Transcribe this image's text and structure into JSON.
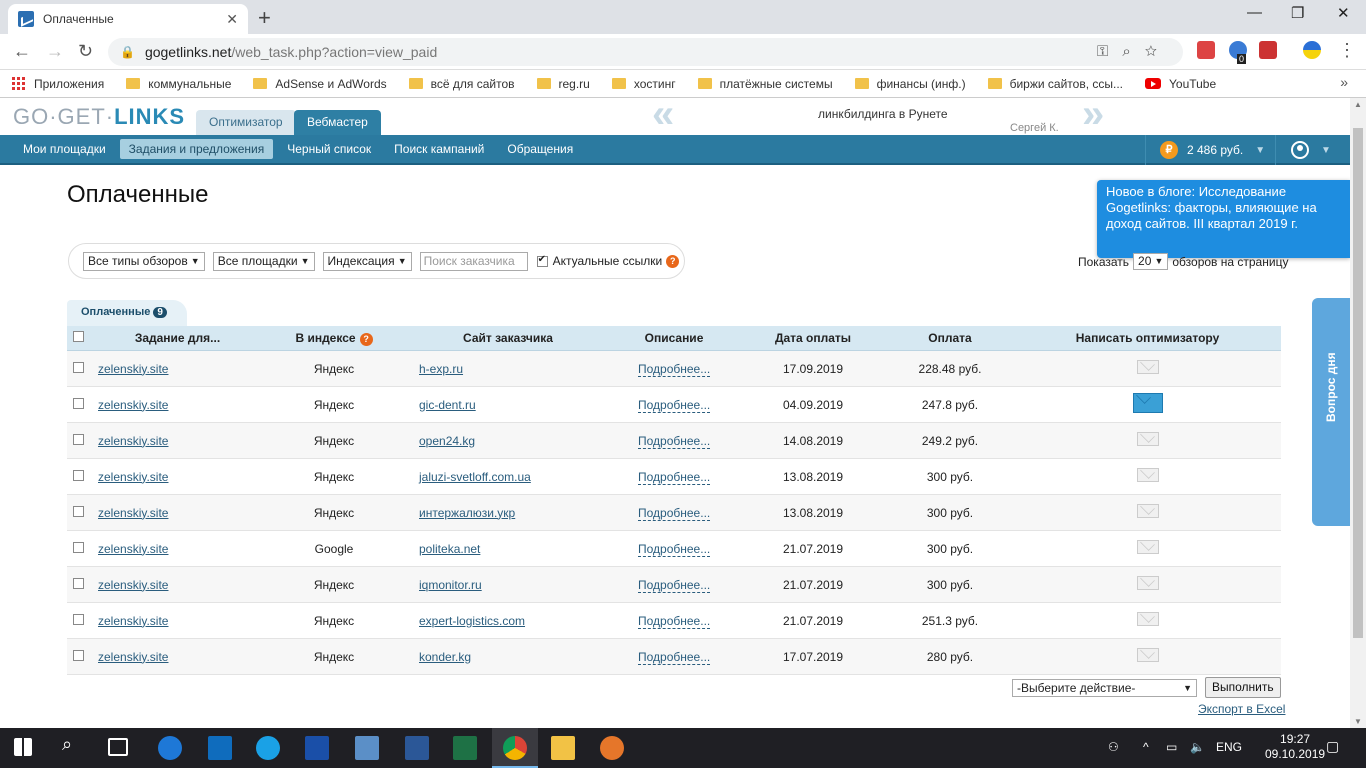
{
  "browser": {
    "tab_title": "Оплаченные",
    "url_host": "gogetlinks.net",
    "url_path": "/web_task.php?action=view_paid",
    "ext_badge": "0"
  },
  "bookmarks": [
    {
      "label": "Приложения",
      "icon": "apps-icon"
    },
    {
      "label": "коммунальные",
      "icon": "folder-icon"
    },
    {
      "label": "AdSense и AdWords",
      "icon": "folder-icon"
    },
    {
      "label": "всё для сайтов",
      "icon": "folder-icon"
    },
    {
      "label": "reg.ru",
      "icon": "folder-icon"
    },
    {
      "label": "хостинг",
      "icon": "folder-icon"
    },
    {
      "label": "платёжные системы",
      "icon": "folder-icon"
    },
    {
      "label": "финансы (инф.)",
      "icon": "folder-icon"
    },
    {
      "label": "биржи сайтов, ссы...",
      "icon": "folder-icon"
    },
    {
      "label": "YouTube",
      "icon": "youtube-icon"
    }
  ],
  "header": {
    "logo_left": "GO·GET·",
    "logo_right": "LINKS",
    "role_tabs": [
      "Оптимизатор",
      "Вебмастер"
    ],
    "banner_text": "линкбилдинга в Рунете",
    "banner_author": "Сергей К.",
    "nav": [
      "Мои площадки",
      "Задания и предложения",
      "Черный список",
      "Поиск кампаний",
      "Обращения"
    ],
    "balance": "2 486 руб.",
    "coin": "₽"
  },
  "page": {
    "title": "Оплаченные",
    "blog": "Новое в блоге: Исследование Gogetlinks: факторы, влияющие на доход сайтов. III квартал 2019 г.",
    "question_day": "Вопрос дня"
  },
  "filters": {
    "review_type": "Все типы обзоров",
    "sites": "Все площадки",
    "indexing": "Индексация",
    "customer_placeholder": "Поиск заказчика",
    "actual_links": "Актуальные ссылки",
    "perpage_prefix": "Показать",
    "perpage_value": "20",
    "perpage_suffix": "обзоров на страницу"
  },
  "table": {
    "tab_label": "Оплаченные",
    "tab_count": "9",
    "columns": [
      "Задание для...",
      "В индексе",
      "Сайт заказчика",
      "Описание",
      "Дата оплаты",
      "Оплата",
      "Написать оптимизатору"
    ],
    "rows": [
      {
        "site": "zelenskiy.site",
        "index": "Яндекс",
        "customer": "h-exp.ru",
        "desc": "Подробнее...",
        "date": "17.09.2019",
        "pay": "228.48 руб.",
        "new_msg": false
      },
      {
        "site": "zelenskiy.site",
        "index": "Яндекс",
        "customer": "gic-dent.ru",
        "desc": "Подробнее...",
        "date": "04.09.2019",
        "pay": "247.8 руб.",
        "new_msg": true
      },
      {
        "site": "zelenskiy.site",
        "index": "Яндекс",
        "customer": "open24.kg",
        "desc": "Подробнее...",
        "date": "14.08.2019",
        "pay": "249.2 руб.",
        "new_msg": false
      },
      {
        "site": "zelenskiy.site",
        "index": "Яндекс",
        "customer": "jaluzi-svetloff.com.ua",
        "desc": "Подробнее...",
        "date": "13.08.2019",
        "pay": "300 руб.",
        "new_msg": false
      },
      {
        "site": "zelenskiy.site",
        "index": "Яндекс",
        "customer": "интержалюзи.укр",
        "desc": "Подробнее...",
        "date": "13.08.2019",
        "pay": "300 руб.",
        "new_msg": false
      },
      {
        "site": "zelenskiy.site",
        "index": "Google",
        "customer": "politeka.net",
        "desc": "Подробнее...",
        "date": "21.07.2019",
        "pay": "300 руб.",
        "new_msg": false
      },
      {
        "site": "zelenskiy.site",
        "index": "Яндекс",
        "customer": "iqmonitor.ru",
        "desc": "Подробнее...",
        "date": "21.07.2019",
        "pay": "300 руб.",
        "new_msg": false
      },
      {
        "site": "zelenskiy.site",
        "index": "Яндекс",
        "customer": "expert-logistics.com",
        "desc": "Подробнее...",
        "date": "21.07.2019",
        "pay": "251.3 руб.",
        "new_msg": false
      },
      {
        "site": "zelenskiy.site",
        "index": "Яндекс",
        "customer": "konder.kg",
        "desc": "Подробнее...",
        "date": "17.07.2019",
        "pay": "280 руб.",
        "new_msg": false
      }
    ]
  },
  "footer": {
    "action_select": "-Выберите действие-",
    "execute": "Выполнить",
    "export": "Экспорт в Excel"
  },
  "taskbar": {
    "lang": "ENG",
    "time": "19:27",
    "date": "09.10.2019"
  },
  "colors": {
    "nav_bg": "#2b7aa0",
    "blog_bg": "#1e8de0",
    "header_row": "#d6e8f2",
    "link": "#2a5d7e"
  }
}
